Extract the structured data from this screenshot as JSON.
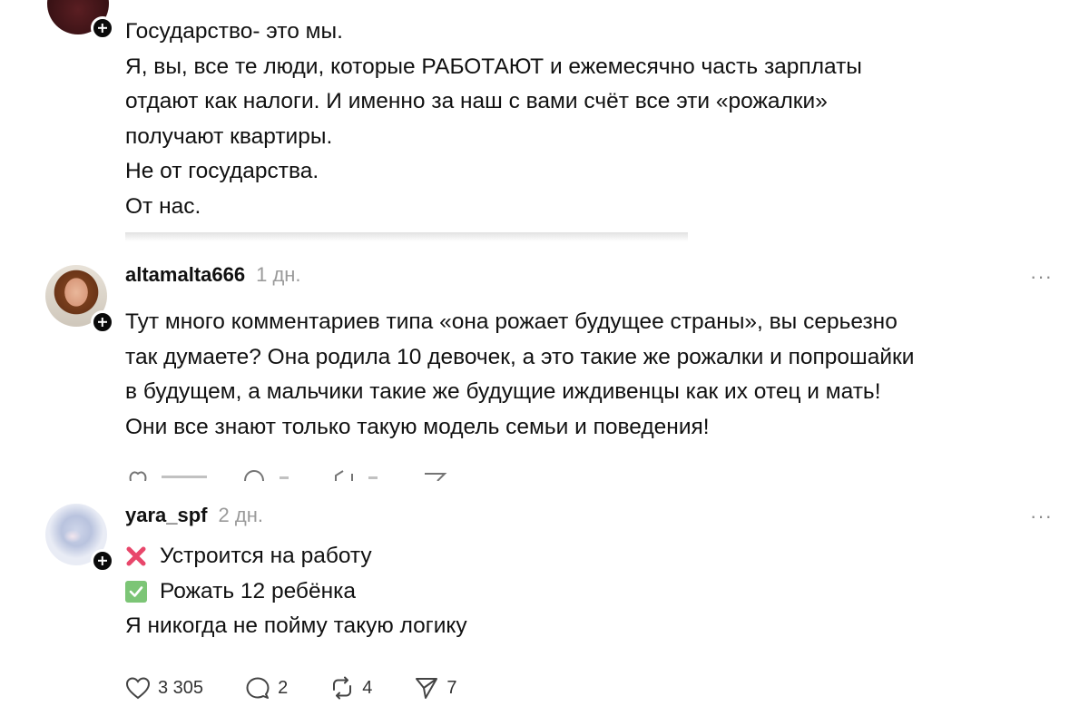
{
  "post1": {
    "lines": [
      "Государство- это мы.",
      "Я, вы, все те люди, которые РАБОТАЮТ и ежемесячно часть зарплаты",
      "отдают как налоги. И именно за наш с вами счёт все эти «рожалки»",
      "получают квартиры.",
      "Не от государства.",
      "От нас."
    ]
  },
  "post2": {
    "username": "altamalta666",
    "time": "1 дн.",
    "more": "···",
    "lines": [
      "Тут много комментариев типа «она рожает будущее страны», вы серьезно",
      "так думаете? Она родила 10 девочек, а это такие же рожалки и попрошайки",
      "в будущем, а мальчики такие же будущие иждивенцы как их отец и мать!",
      "Они все знают только такую модель семьи и поведения!"
    ]
  },
  "post3": {
    "username": "yara_spf",
    "time": "2 дн.",
    "more": "···",
    "line1": "Устроится на работу",
    "line1_icon": "cross-mark-icon",
    "line2": "Рожать 12 ребёнка",
    "line2_icon": "check-mark-icon",
    "line3": "Я никогда не пойму такую логику",
    "actions": {
      "likes": "3 305",
      "replies": "2",
      "reposts": "4",
      "shares": "7"
    }
  },
  "colors": {
    "cross": "#e8476b",
    "check": "#7cc576",
    "muted": "#9a9a9a"
  }
}
